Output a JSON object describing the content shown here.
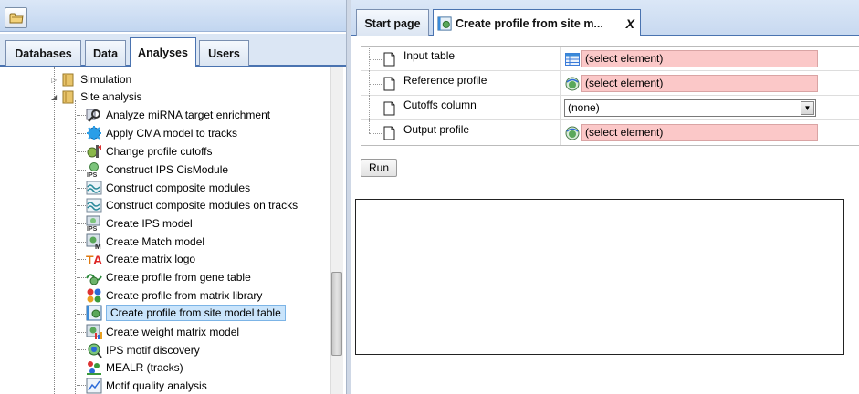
{
  "left_panel": {
    "tabs": [
      {
        "label": "Databases",
        "active": false
      },
      {
        "label": "Data",
        "active": false
      },
      {
        "label": "Analyses",
        "active": true
      },
      {
        "label": "Users",
        "active": false
      }
    ],
    "tree": {
      "folders": [
        {
          "label": "Simulation",
          "icon": "folder-icon"
        },
        {
          "label": "Site analysis",
          "icon": "folder-open-icon",
          "expanded": true
        }
      ],
      "items": [
        {
          "label": "Analyze miRNA target enrichment",
          "icon": "magnifier-icon",
          "selected": false
        },
        {
          "label": "Apply CMA model to tracks",
          "icon": "gear-icon",
          "selected": false
        },
        {
          "label": "Change profile cutoffs",
          "icon": "cutoff-icon",
          "selected": false
        },
        {
          "label": "Construct IPS CisModule",
          "icon": "ips-icon",
          "selected": false
        },
        {
          "label": "Construct composite modules",
          "icon": "wave-icon",
          "selected": false
        },
        {
          "label": "Construct composite modules on tracks",
          "icon": "wave-icon",
          "selected": false
        },
        {
          "label": "Create IPS model",
          "icon": "ips-icon",
          "selected": false
        },
        {
          "label": "Create Match model",
          "icon": "match-icon",
          "selected": false
        },
        {
          "label": "Create matrix logo",
          "icon": "logo-icon",
          "selected": false
        },
        {
          "label": "Create profile from gene table",
          "icon": "gene-profile-icon",
          "selected": false
        },
        {
          "label": "Create profile from matrix library",
          "icon": "matrix-library-icon",
          "selected": false
        },
        {
          "label": "Create profile from site model table",
          "icon": "table-profile-icon",
          "selected": true
        },
        {
          "label": "Create weight matrix model",
          "icon": "weight-matrix-icon",
          "selected": false
        },
        {
          "label": "IPS motif discovery",
          "icon": "motif-icon",
          "selected": false
        },
        {
          "label": "MEALR (tracks)",
          "icon": "mealr-icon",
          "selected": false
        },
        {
          "label": "Motif quality analysis",
          "icon": "chart-icon",
          "selected": false
        }
      ]
    }
  },
  "right_panel": {
    "tabs": [
      {
        "label": "Start page",
        "active": false
      },
      {
        "label": "Create profile from site m...",
        "active": true,
        "close": "X"
      }
    ],
    "form": [
      {
        "label": "Input table",
        "type": "picker",
        "icon": "table-icon",
        "value": "(select element)"
      },
      {
        "label": "Reference profile",
        "type": "picker",
        "icon": "profile-icon",
        "value": "(select element)"
      },
      {
        "label": "Cutoffs column",
        "type": "select",
        "value": "(none)"
      },
      {
        "label": "Output profile",
        "type": "picker",
        "icon": "profile-icon",
        "value": "(select element)"
      }
    ],
    "run_label": "Run"
  },
  "colors": {
    "accent": "#4a73b0",
    "invalid_field": "#fbc8c8",
    "selected_item": "#c9e4fb"
  }
}
